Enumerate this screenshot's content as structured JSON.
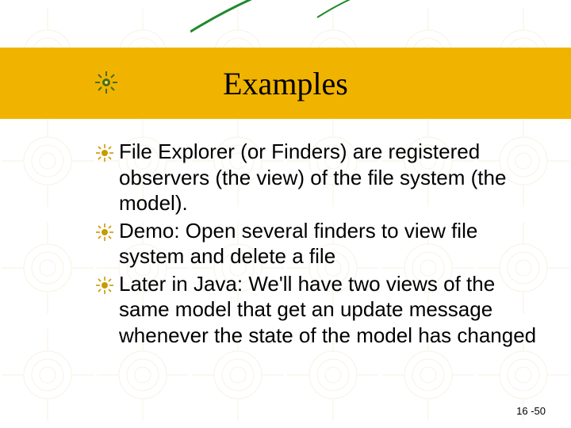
{
  "slide": {
    "title": "Examples",
    "bullets": [
      "File Explorer (or Finders) are registered observers (the view) of the file system (the model).",
      "Demo: Open several finders to view file system and delete a file",
      "Later in Java: We'll have two views of the same model that get an update message whenever the state of the model has changed"
    ],
    "slide_number": "16 -50"
  }
}
